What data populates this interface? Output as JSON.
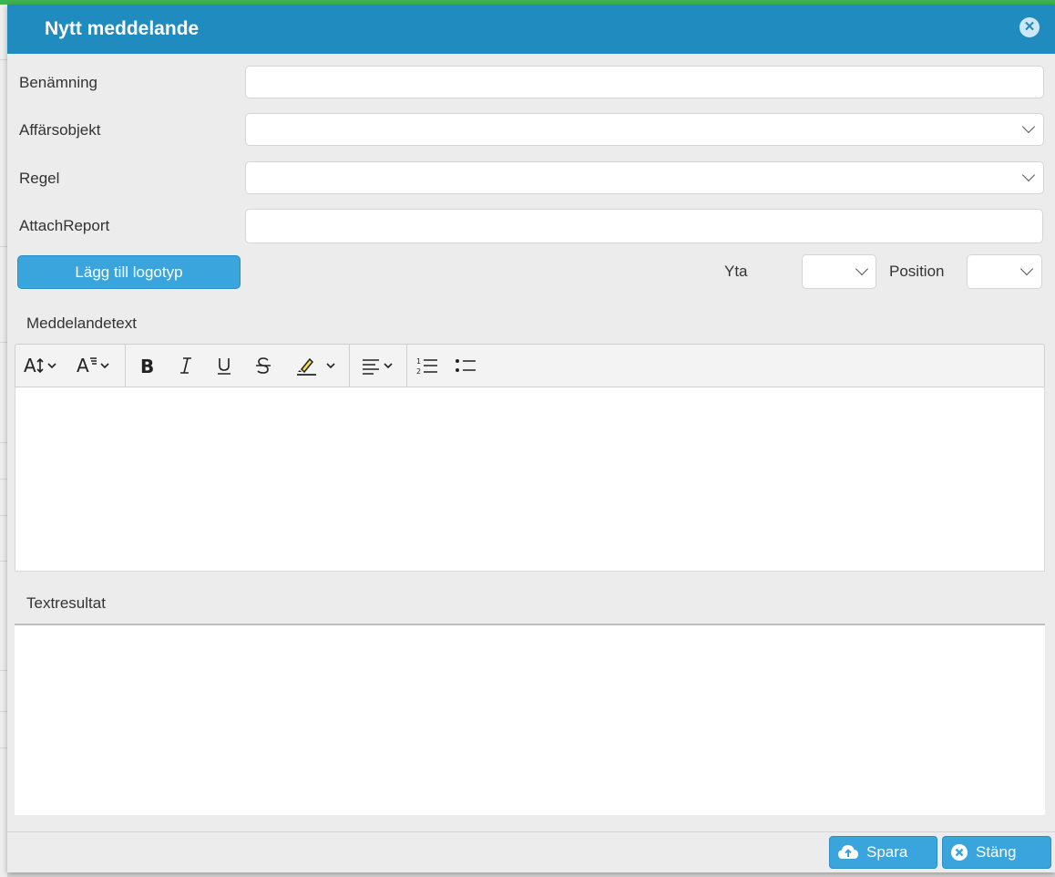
{
  "dialog": {
    "title": "Nytt meddelande"
  },
  "form": {
    "benamning_label": "Benämning",
    "benamning_value": "",
    "affarsobjekt_label": "Affärsobjekt",
    "affarsobjekt_value": "",
    "regel_label": "Regel",
    "regel_value": "",
    "attachreport_label": "AttachReport",
    "attachreport_value": "",
    "logo_button": "Lägg till logotyp",
    "yta_label": "Yta",
    "yta_value": "",
    "position_label": "Position",
    "position_value": ""
  },
  "editor": {
    "label": "Meddelandetext",
    "toolbar": [
      "font-size-icon",
      "font-family-icon",
      "bold-icon",
      "italic-icon",
      "underline-icon",
      "strikethrough-icon",
      "highlight-icon",
      "align-left-icon",
      "ordered-list-icon",
      "bullet-list-icon"
    ],
    "content": ""
  },
  "result": {
    "label": "Textresultat",
    "content": ""
  },
  "footer": {
    "save_label": "Spara",
    "close_label": "Stäng"
  },
  "colors": {
    "header": "#1f8bbf",
    "button": "#3aa4dd",
    "top_strip": "#3fb34f"
  }
}
